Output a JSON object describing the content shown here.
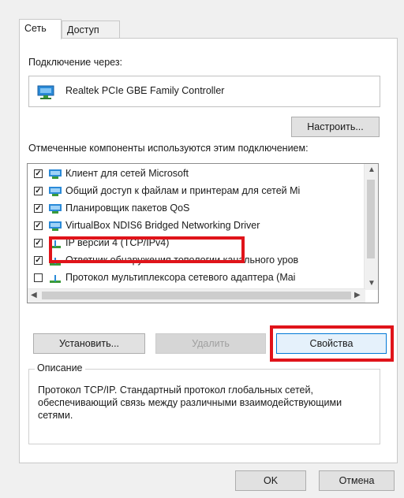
{
  "tabs": {
    "network": "Сеть",
    "access": "Доступ"
  },
  "connect_via_label": "Подключение через:",
  "adapter_name": "Realtek PCIe GBE Family Controller",
  "configure_button": "Настроить...",
  "components_label": "Отмеченные компоненты используются этим подключением:",
  "components": [
    {
      "label": "Клиент для сетей Microsoft",
      "checked": true,
      "icon": "network-client-icon"
    },
    {
      "label": "Общий доступ к файлам и принтерам для сетей Mi",
      "checked": true,
      "icon": "file-sharing-icon"
    },
    {
      "label": "Планировщик пакетов QoS",
      "checked": true,
      "icon": "qos-icon"
    },
    {
      "label": "VirtualBox NDIS6 Bridged Networking Driver",
      "checked": true,
      "icon": "driver-icon"
    },
    {
      "label": "IP версии 4 (TCP/IPv4)",
      "checked": true,
      "icon": "protocol-icon"
    },
    {
      "label": "Ответчик обнаружения топологии канального уров",
      "checked": true,
      "icon": "protocol-icon"
    },
    {
      "label": "Протокол мультиплексора сетевого адаптера (Mai",
      "checked": false,
      "icon": "protocol-icon"
    }
  ],
  "buttons": {
    "install": "Установить...",
    "remove": "Удалить",
    "properties": "Свойства",
    "ok": "OK",
    "cancel": "Отмена"
  },
  "description_title": "Описание",
  "description_text": "Протокол TCP/IP. Стандартный протокол глобальных сетей, обеспечивающий связь между различными взаимодействующими сетями.",
  "colors": {
    "highlight": "#e0141a",
    "accent": "#1e7fd2"
  }
}
